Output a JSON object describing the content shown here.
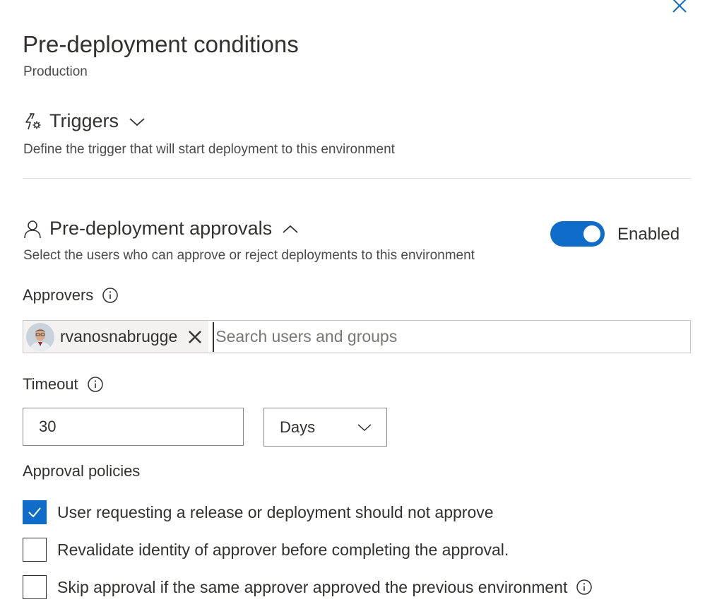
{
  "panel": {
    "title": "Pre-deployment conditions",
    "environment": "Production"
  },
  "triggers": {
    "heading": "Triggers",
    "description": "Define the trigger that will start deployment to this environment",
    "icon": "lightning-gear-icon",
    "expanded": false
  },
  "approvals": {
    "heading": "Pre-deployment approvals",
    "description": "Select the users who can approve or reject deployments to this environment",
    "icon": "person-icon",
    "expanded": true,
    "toggle_label": "Enabled",
    "enabled": true,
    "approvers_label": "Approvers",
    "approvers": [
      {
        "name": "rvanosnabrugge"
      }
    ],
    "search_placeholder": "Search users and groups",
    "timeout_label": "Timeout",
    "timeout_value": "30",
    "timeout_unit": "Days",
    "policies_label": "Approval policies",
    "policies": [
      {
        "label": "User requesting a release or deployment should not approve",
        "checked": true
      },
      {
        "label": "Revalidate identity of approver before completing the approval.",
        "checked": false
      },
      {
        "label": "Skip approval if the same approver approved the previous environment",
        "checked": false
      }
    ]
  },
  "colors": {
    "accent": "#0f6cc9",
    "text": "#323130",
    "border": "#8a8886"
  }
}
